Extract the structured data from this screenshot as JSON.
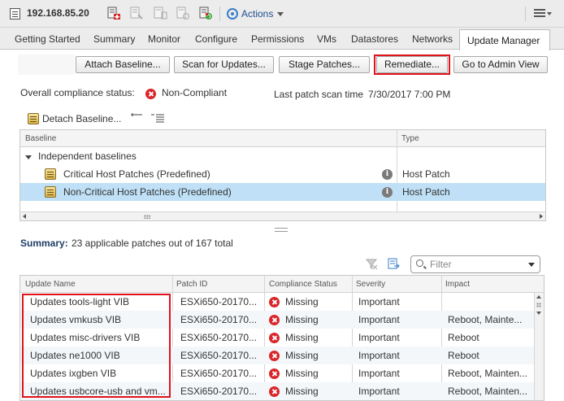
{
  "header": {
    "host": "192.168.85.20",
    "actions_label": "Actions",
    "toolbar_icons": [
      "host-icon",
      "add-host-icon",
      "host-maintenance-icon",
      "host-power-icon",
      "host-settings-icon",
      "host-refresh-icon",
      "gear-icon",
      "menu-icon"
    ]
  },
  "tabs": [
    "Getting Started",
    "Summary",
    "Monitor",
    "Configure",
    "Permissions",
    "VMs",
    "Datastores",
    "Networks",
    "Update Manager"
  ],
  "active_tab": "Update Manager",
  "buttons": {
    "attach": "Attach Baseline...",
    "scan": "Scan for Updates...",
    "stage": "Stage Patches...",
    "remediate": "Remediate...",
    "admin": "Go to Admin View"
  },
  "compliance": {
    "label": "Overall compliance status:",
    "status": "Non-Compliant",
    "scan_label": "Last patch scan time",
    "scan_time": "7/30/2017 7:00 PM"
  },
  "baselines": {
    "detach_label": "Detach Baseline...",
    "columns": [
      "Baseline",
      "Type"
    ],
    "group": "Independent baselines",
    "rows": [
      {
        "name": "Critical Host Patches (Predefined)",
        "type": "Host Patch"
      },
      {
        "name": "Non-Critical Host Patches (Predefined)",
        "type": "Host Patch"
      }
    ]
  },
  "summary": {
    "label": "Summary:",
    "text": "23 applicable patches out of 167 total"
  },
  "filter": {
    "placeholder": "Filter"
  },
  "patches": {
    "columns": [
      "Update Name",
      "Patch ID",
      "Compliance Status",
      "Severity",
      "Impact"
    ],
    "rows": [
      {
        "name": "Updates tools-light VIB",
        "patch_id": "ESXi650-20170...",
        "status": "Missing",
        "severity": "Important",
        "impact": ""
      },
      {
        "name": "Updates vmkusb VIB",
        "patch_id": "ESXi650-20170...",
        "status": "Missing",
        "severity": "Important",
        "impact": "Reboot, Mainte..."
      },
      {
        "name": "Updates misc-drivers VIB",
        "patch_id": "ESXi650-20170...",
        "status": "Missing",
        "severity": "Important",
        "impact": "Reboot"
      },
      {
        "name": "Updates ne1000 VIB",
        "patch_id": "ESXi650-20170...",
        "status": "Missing",
        "severity": "Important",
        "impact": "Reboot"
      },
      {
        "name": "Updates ixgben VIB",
        "patch_id": "ESXi650-20170...",
        "status": "Missing",
        "severity": "Important",
        "impact": "Reboot, Mainten..."
      },
      {
        "name": "Updates usbcore-usb and vm...",
        "patch_id": "ESXi650-20170...",
        "status": "Missing",
        "severity": "Important",
        "impact": "Reboot, Mainten..."
      }
    ]
  },
  "colors": {
    "highlight": "#e0131b",
    "selected_row": "#bfe0f6",
    "error": "#d9262a"
  }
}
